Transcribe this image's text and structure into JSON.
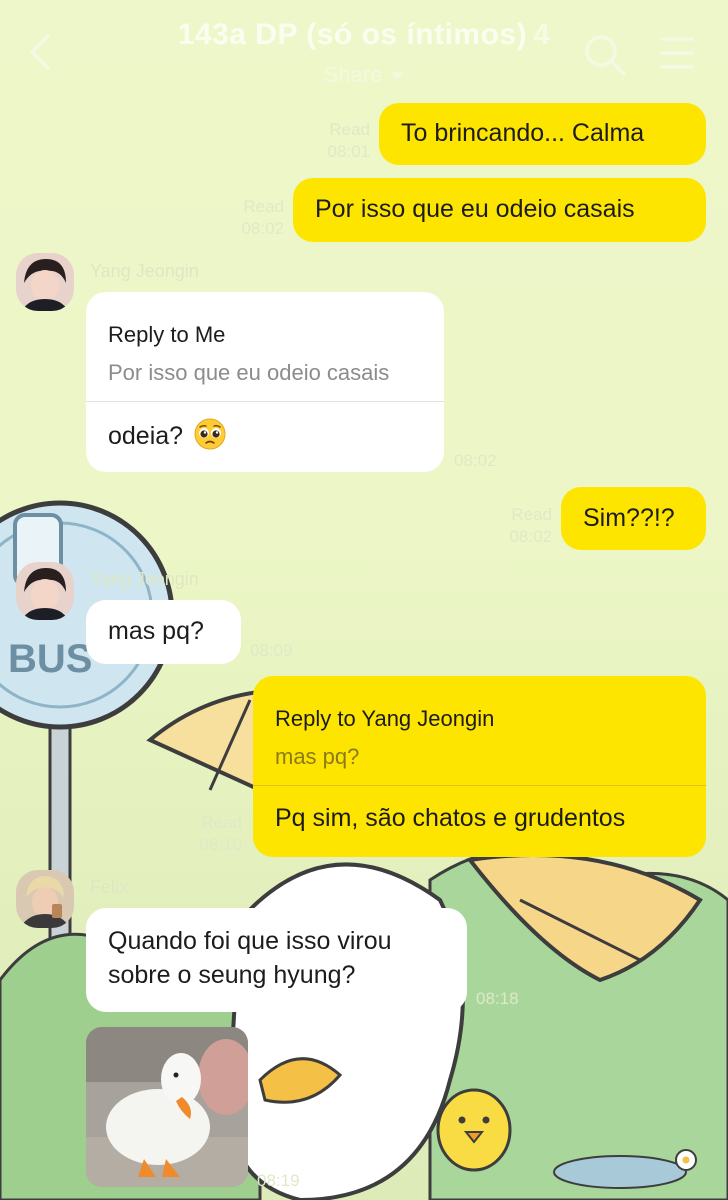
{
  "header": {
    "title": "143a DP (só os íntimos)",
    "member_count": "4",
    "share_label": "Share",
    "back_icon": "chevron-left-icon",
    "search_icon": "search-icon",
    "menu_icon": "hamburger-menu-icon"
  },
  "colors": {
    "outgoing_bubble": "#fee500",
    "incoming_bubble": "#ffffff",
    "wallpaper": "#eef7c9"
  },
  "messages": [
    {
      "direction": "out",
      "text": "To brincando... Calma",
      "read": "Read",
      "time": "08:01"
    },
    {
      "direction": "out",
      "text": "Por isso que eu odeio casais",
      "read": "Read",
      "time": "08:02"
    },
    {
      "direction": "in",
      "sender": "Yang Jeongin",
      "reply_to": "Reply to Me",
      "quoted": "Por isso que eu odeio casais",
      "text": "odeia?",
      "emoji": "pleading-face",
      "time": "08:02"
    },
    {
      "direction": "out",
      "text": "Sim??!?",
      "read": "Read",
      "time": "08:02"
    },
    {
      "direction": "in",
      "sender": "Yang Jeongin",
      "text": "mas pq?",
      "time": "08:09"
    },
    {
      "direction": "out",
      "reply_to": "Reply to Yang Jeongin",
      "quoted": "mas pq?",
      "text": "Pq sim, são chatos e grudentos",
      "read": "Read",
      "time": "08:10"
    },
    {
      "direction": "in",
      "sender": "Felix",
      "text_line1": "Quando foi que isso virou",
      "text_line2": "sobre o seung hyung?",
      "time": "08:18"
    },
    {
      "direction": "in",
      "type": "photo",
      "photo_subject": "white duck",
      "time": "08:19"
    }
  ]
}
